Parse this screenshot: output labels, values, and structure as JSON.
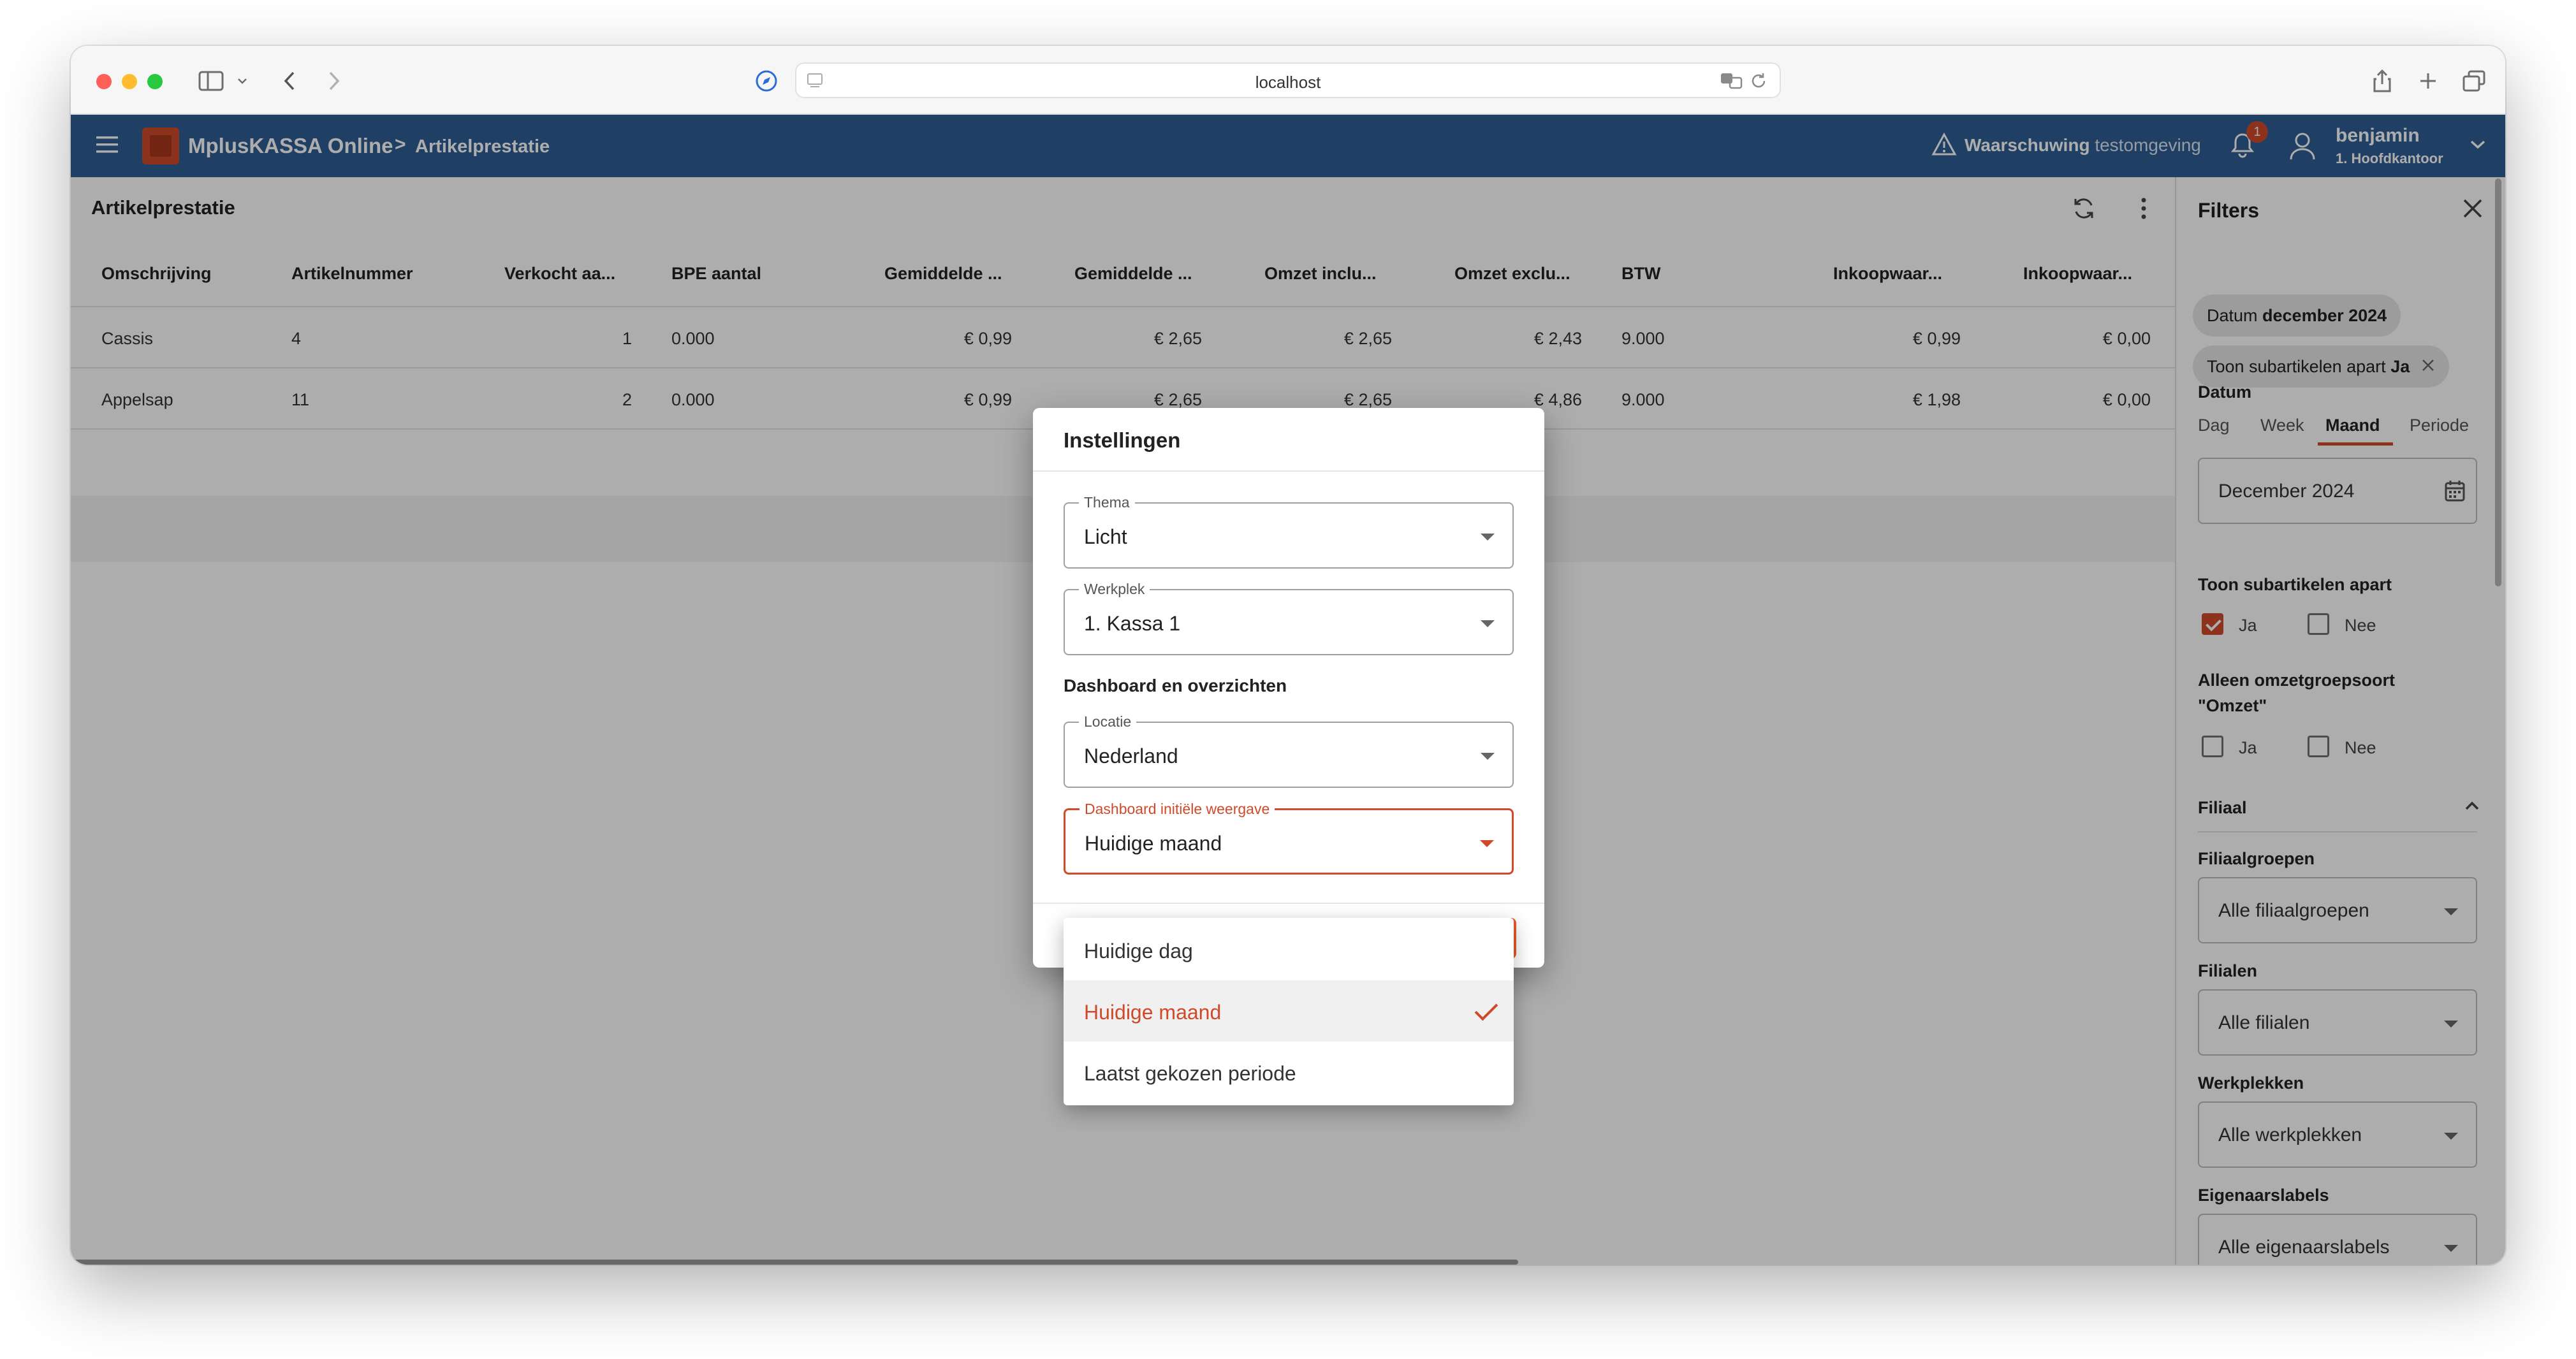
{
  "browser": {
    "url": "localhost"
  },
  "app": {
    "name": "MplusKASSA Online",
    "breadcrumb_sep": ">",
    "page": "Artikelprestatie",
    "warning_bold": "Waarschuwing",
    "warning_rest": " testomgeving",
    "notification_count": "1",
    "user_name": "benjamin",
    "user_branch": "1. Hoofdkantoor"
  },
  "report": {
    "title": "Artikelprestatie",
    "columns": [
      "Omschrijving",
      "Artikelnummer",
      "Verkocht aa...",
      "BPE aantal",
      "Gemiddelde ...",
      "Gemiddelde ...",
      "Omzet inclu...",
      "Omzet exclu...",
      "BTW",
      "Inkoopwaar...",
      "Inkoopwaar..."
    ],
    "rows": [
      [
        "Cassis",
        "4",
        "1",
        "0.000",
        "€ 0,99",
        "€ 2,65",
        "€ 2,65",
        "€ 2,43",
        "9.000",
        "€ 0,99",
        "€ 0,00"
      ],
      [
        "Appelsap",
        "11",
        "2",
        "0.000",
        "€ 0,99",
        "€ 2,65",
        "€ 2,65",
        "€ 4,86",
        "9.000",
        "€ 1,98",
        "€ 0,00"
      ]
    ]
  },
  "filters": {
    "title": "Filters",
    "chip_date_label": "Datum ",
    "chip_date_value": "december 2024",
    "chip_sub_label": "Toon subartikelen apart ",
    "chip_sub_value": "Ja",
    "datum_label": "Datum",
    "tabs": [
      "Dag",
      "Week",
      "Maand",
      "Periode"
    ],
    "active_tab": "Maand",
    "date_value": "December 2024",
    "subartikelen_label": "Toon subartikelen apart",
    "ja": "Ja",
    "nee": "Nee",
    "omzet_label_1": "Alleen omzetgroepsoort",
    "omzet_label_2": "\"Omzet\"",
    "filiaal_section": "Filiaal",
    "filiaalgroepen_label": "Filiaalgroepen",
    "filiaalgroepen_value": "Alle filiaalgroepen",
    "filialen_label": "Filialen",
    "filialen_value": "Alle filialen",
    "werkplekken_label": "Werkplekken",
    "werkplekken_value": "Alle werkplekken",
    "eigenaarslabels_label": "Eigenaarslabels",
    "eigenaarslabels_value": "Alle eigenaarslabels"
  },
  "dialog": {
    "title": "Instellingen",
    "thema_label": "Thema",
    "thema_value": "Licht",
    "werkplek_label": "Werkplek",
    "werkplek_value": "1. Kassa 1",
    "section": "Dashboard en overzichten",
    "locatie_label": "Locatie",
    "locatie_value": "Nederland",
    "weergave_label": "Dashboard initiële weergave",
    "weergave_value": "Huidige maand",
    "options": [
      "Huidige dag",
      "Huidige maand",
      "Laatst gekozen periode"
    ],
    "selected_option": "Huidige maand"
  },
  "colors": {
    "appbar": "#2e5f94",
    "accent": "#d04a2a"
  }
}
